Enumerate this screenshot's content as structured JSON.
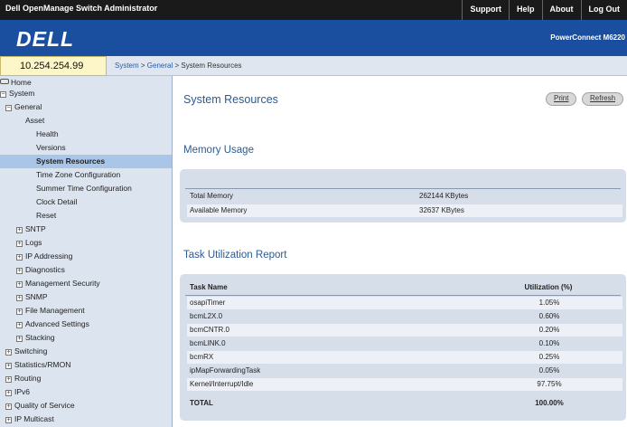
{
  "app": {
    "title": "Dell OpenManage Switch Administrator",
    "links": [
      "Support",
      "Help",
      "About",
      "Log Out"
    ]
  },
  "brand": {
    "logo": "DELL",
    "model": "PowerConnect M6220"
  },
  "address": {
    "ip": "10.254.254.99"
  },
  "breadcrumb": {
    "items": [
      "System",
      "General"
    ],
    "current": "System Resources",
    "sep": " > "
  },
  "sidebar": {
    "home": "Home",
    "items": [
      {
        "label": "System",
        "toggle": "−"
      },
      {
        "label": "General",
        "toggle": "−"
      },
      {
        "label": "Asset"
      },
      {
        "label": "Health"
      },
      {
        "label": "Versions"
      },
      {
        "label": "System Resources",
        "selected": true
      },
      {
        "label": "Time Zone Configuration"
      },
      {
        "label": "Summer Time Configuration"
      },
      {
        "label": "Clock Detail"
      },
      {
        "label": "Reset"
      },
      {
        "label": "SNTP",
        "toggle": "+"
      },
      {
        "label": "Logs",
        "toggle": "+"
      },
      {
        "label": "IP Addressing",
        "toggle": "+"
      },
      {
        "label": "Diagnostics",
        "toggle": "+"
      },
      {
        "label": "Management Security",
        "toggle": "+"
      },
      {
        "label": "SNMP",
        "toggle": "+"
      },
      {
        "label": "File Management",
        "toggle": "+"
      },
      {
        "label": "Advanced Settings",
        "toggle": "+"
      },
      {
        "label": "Stacking",
        "toggle": "+"
      },
      {
        "label": "Switching",
        "toggle": "+"
      },
      {
        "label": "Statistics/RMON",
        "toggle": "+"
      },
      {
        "label": "Routing",
        "toggle": "+"
      },
      {
        "label": "IPv6",
        "toggle": "+"
      },
      {
        "label": "Quality of Service",
        "toggle": "+"
      },
      {
        "label": "IP Multicast",
        "toggle": "+"
      }
    ]
  },
  "main": {
    "title": "System Resources",
    "print_label": "Print",
    "refresh_label": "Refresh",
    "memory": {
      "title": "Memory Usage",
      "rows": [
        {
          "label": "Total Memory",
          "value": "262144 KBytes"
        },
        {
          "label": "Available Memory",
          "value": "32637 KBytes"
        }
      ]
    },
    "tasks": {
      "title": "Task Utilization Report",
      "col_task": "Task Name",
      "col_util": "Utilization (%)",
      "rows": [
        {
          "name": "osapiTimer",
          "util": "1.05%"
        },
        {
          "name": "bcmL2X.0",
          "util": "0.60%"
        },
        {
          "name": "bcmCNTR.0",
          "util": "0.20%"
        },
        {
          "name": "bcmLINK.0",
          "util": "0.10%"
        },
        {
          "name": "bcmRX",
          "util": "0.25%"
        },
        {
          "name": "ipMapForwardingTask",
          "util": "0.05%"
        },
        {
          "name": "Kernel/Interrupt/Idle",
          "util": "97.75%"
        }
      ],
      "total_label": "TOTAL",
      "total_value": "100.00%"
    }
  }
}
